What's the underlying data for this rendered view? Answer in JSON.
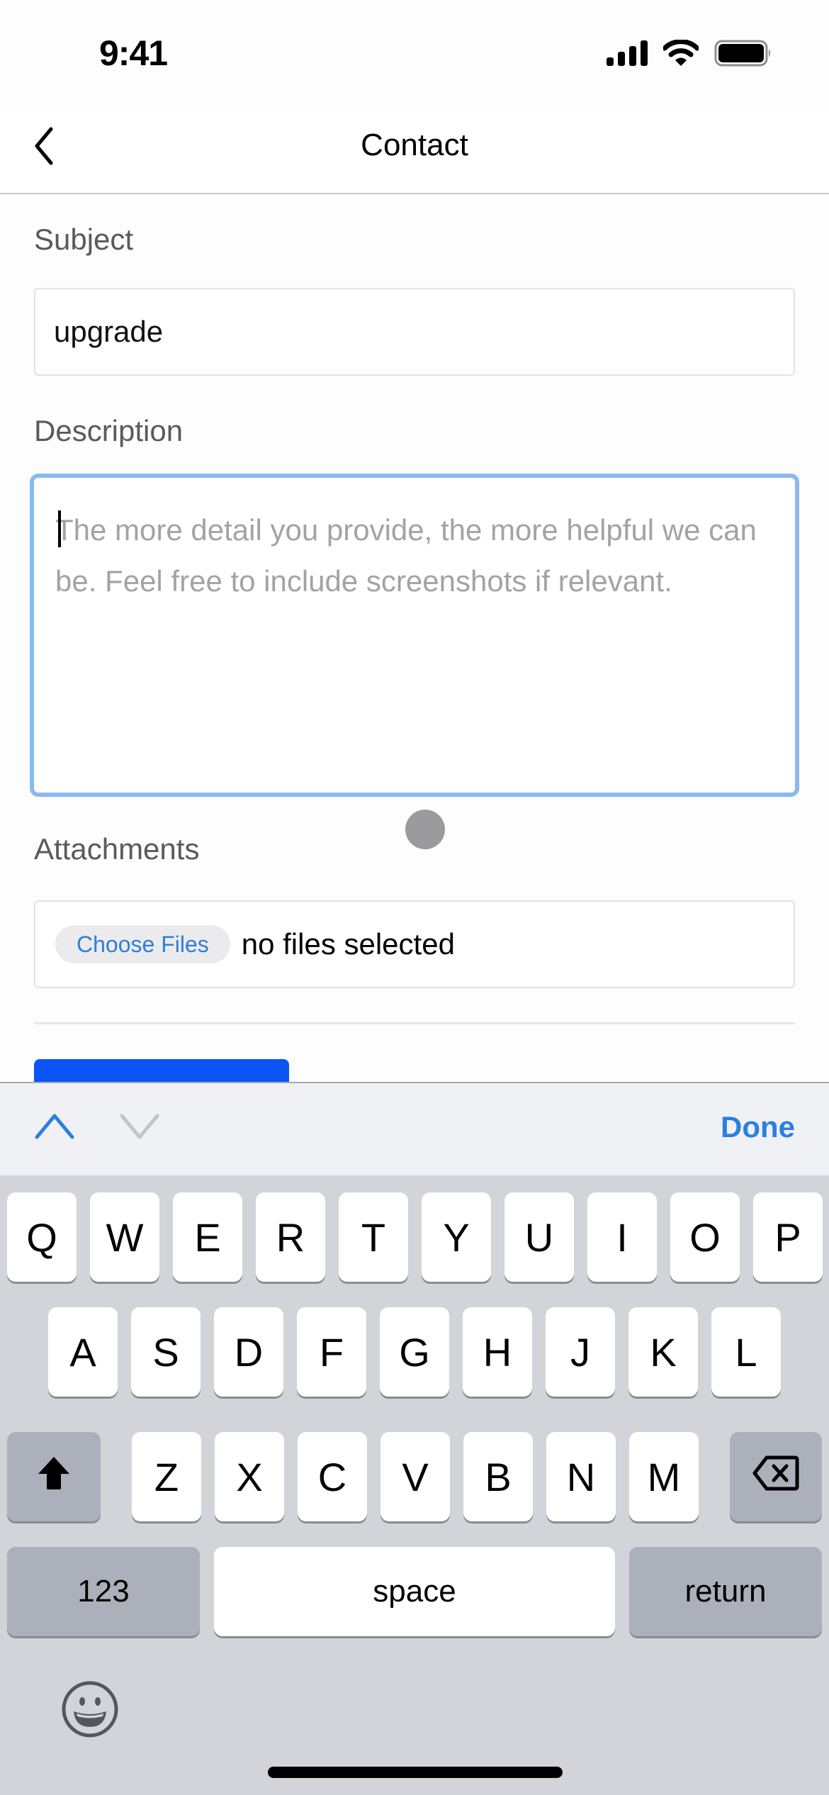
{
  "status_bar": {
    "time": "9:41",
    "icons": [
      "cellular-signal-icon",
      "wifi-icon",
      "battery-icon"
    ]
  },
  "nav": {
    "title": "Contact",
    "back_icon": "chevron-left-icon"
  },
  "form": {
    "subject_label": "Subject",
    "subject_value": "upgrade",
    "description_label": "Description",
    "description_value": "",
    "description_placeholder": "The more detail you provide, the more helpful we can be. Feel free to include screenshots if relevant.",
    "attachments_label": "Attachments",
    "choose_files_label": "Choose Files",
    "file_status": "no files selected",
    "accent_color": "#0b54f6",
    "focus_color": "#8ab8f2"
  },
  "accessory_bar": {
    "prev_icon": "chevron-up-icon",
    "next_icon": "chevron-down-icon",
    "done_label": "Done"
  },
  "keyboard": {
    "row1": [
      "Q",
      "W",
      "E",
      "R",
      "T",
      "Y",
      "U",
      "I",
      "O",
      "P"
    ],
    "row2": [
      "A",
      "S",
      "D",
      "F",
      "G",
      "H",
      "J",
      "K",
      "L"
    ],
    "row3": [
      "Z",
      "X",
      "C",
      "V",
      "B",
      "N",
      "M"
    ],
    "numbers_label": "123",
    "space_label": "space",
    "return_label": "return",
    "shift_icon": "shift-icon",
    "delete_icon": "backspace-icon",
    "emoji_icon": "emoji-icon"
  }
}
